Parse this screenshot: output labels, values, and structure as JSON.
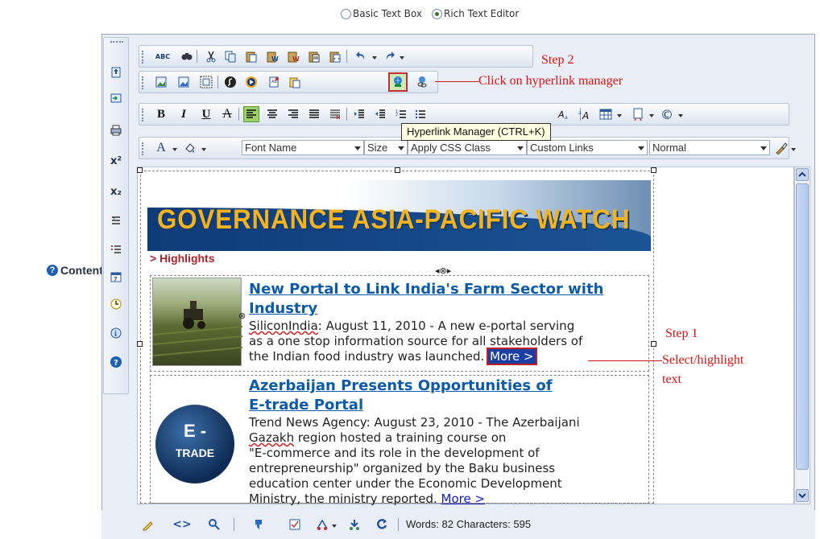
{
  "mode": {
    "basic_label": "Basic Text Box",
    "rich_label": "Rich Text Editor",
    "selected": "rich"
  },
  "form": {
    "content_label": "Content:"
  },
  "toolbar": {
    "tooltip": "Hyperlink Manager (CTRL+K)",
    "font_name": "Font Name",
    "size": "Size",
    "css_class": "Apply CSS Class",
    "custom_links": "Custom Links",
    "paragraph": "Normal",
    "bold": "B",
    "italic": "I",
    "underline": "U",
    "strike": "A",
    "fore_color": "A",
    "spell": "ABC"
  },
  "left_toolbar": {
    "superscript": "x²",
    "subscript": "x₂"
  },
  "banner": {
    "title": "GOVERNANCE  ASIA-PACIFIC  WATCH",
    "section": "> Highlights"
  },
  "articles": [
    {
      "headline_line1": "New Portal to Link India's Farm Sector with",
      "headline_line2": "Industry",
      "source": "SiliconIndia",
      "body_line1": ": August 11, 2010 -  A new e-portal serving",
      "body_line2": "as a one stop information source for all stakeholders of",
      "body_line3": "the Indian food industry was launched. ",
      "more": "More >"
    },
    {
      "headline_line1": "Azerbaijan Presents Opportunities of",
      "headline_line2": "E-trade Portal",
      "body_line1": "Trend News Agency: August 23, 2010 - The Azerbaijani",
      "region": "Gazakh",
      "body_line2": " region hosted a training course on",
      "body_line3": "\"E-commerce and its role in the development of",
      "body_line4": "entrepreneurship\" organized by the Baku business",
      "body_line5": "education center under the Economic Development",
      "body_line6": "Ministry, the ministry reported. ",
      "more": "More >"
    }
  ],
  "etrade_logo": {
    "line1": "E -",
    "line2": "TRADE"
  },
  "annotations": {
    "step2": "Step 2",
    "step2_text": "Click on hyperlink manager",
    "step1": "Step 1",
    "step1_line1": "Select/highlight",
    "step1_line2": "text"
  },
  "status": {
    "counter": "Words: 82 Characters: 595"
  },
  "colors": {
    "accent_red": "#e01010",
    "headline_blue": "#0c5ba8",
    "banner_navy": "#0f3b78",
    "banner_gold": "#f3b21f"
  }
}
